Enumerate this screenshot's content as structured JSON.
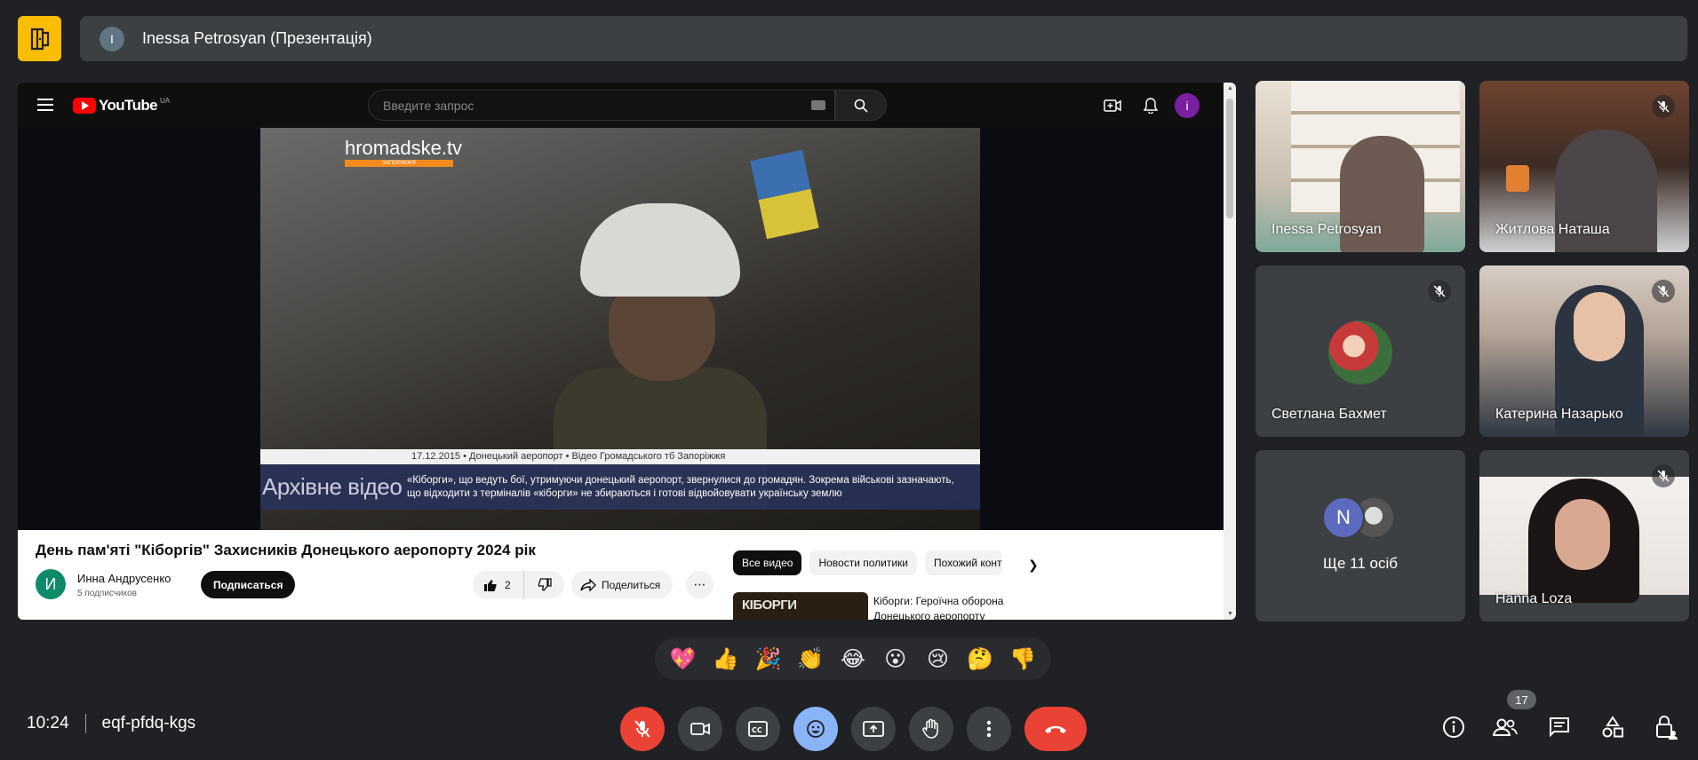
{
  "presenter_bar": {
    "avatar_letter": "I",
    "title": "Inessa Petrosyan (Презентація)"
  },
  "youtube": {
    "logo_text": "YouTube",
    "region": "UA",
    "search_placeholder": "Введите запрос",
    "user_avatar": "i",
    "video": {
      "overlay_logo": "hromadske.tv",
      "overlay_logo_sub": "ЗАПОРІЖЖЯ",
      "lower_third_top": "17.12.2015 • Донецький аеропорт • Відео Громадського тб Запоріжжя",
      "lower_third_label": "Архівне відео",
      "lower_third_text": "«Кіборги», що ведуть бої, утримуючи донецький аеропорт, звернулися до громадян. Зокрема військові зазначають, що відходити з терміналів «кіборги» не збираються і готові відвойовувати українську землю"
    },
    "title": "День пам'яті \"Кіборгів\" Захисників Донецького аеропорту 2024 рік",
    "channel": {
      "avatar_letter": "И",
      "name": "Инна Андрусенко",
      "subscribers": "5 подписчиков",
      "subscribe_label": "Подписаться"
    },
    "likes": "2",
    "share_label": "Поделиться",
    "chips": [
      "Все видео",
      "Новости политики",
      "Похожий контент"
    ],
    "recommended": {
      "thumb_text": "КІБОРГИ",
      "title": "Кіборги: Героїчна оборона Донецького аеропорту"
    }
  },
  "participants": [
    {
      "name": "Inessa Petrosyan",
      "muted": false
    },
    {
      "name": "Житлова Наташа",
      "muted": true
    },
    {
      "name": "Светлана Бахмет",
      "muted": true
    },
    {
      "name": "Катерина Назарько",
      "muted": true
    },
    {
      "name": "Ще 11 осіб",
      "avatar_letter": "N"
    },
    {
      "name": "Hanna Loza",
      "muted": true
    }
  ],
  "reactions": [
    "💖",
    "👍",
    "🎉",
    "👏",
    "😂",
    "😮",
    "😢",
    "🤔",
    "👎"
  ],
  "meeting": {
    "time": "10:24",
    "code": "eqf-pfdq-kgs",
    "people_count": "17"
  },
  "colors": {
    "background": "#202124",
    "tile": "#3c4043",
    "mic_off_red": "#ea4335",
    "reaction_active": "#8ab4f8",
    "presenter_icon": "#fbbc04"
  }
}
